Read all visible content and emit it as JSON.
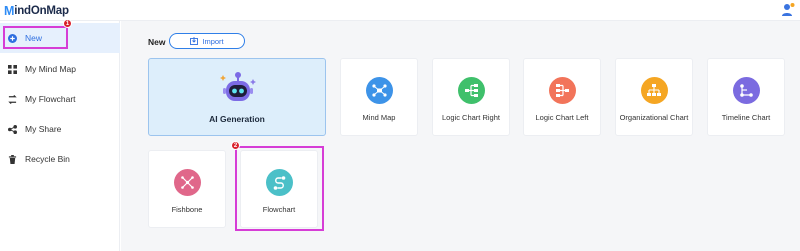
{
  "app": {
    "logo_prefix": "M",
    "logo_text": "indOnMap"
  },
  "sidebar": {
    "items": [
      {
        "label": "New",
        "icon": "plus-circle-icon",
        "active": true
      },
      {
        "label": "My Mind Map",
        "icon": "mind-map-icon"
      },
      {
        "label": "My Flowchart",
        "icon": "flowchart-icon"
      },
      {
        "label": "My Share",
        "icon": "share-icon"
      },
      {
        "label": "Recycle Bin",
        "icon": "trash-icon"
      }
    ]
  },
  "main": {
    "section_label": "New",
    "import_label": "Import",
    "templates": [
      {
        "label": "AI Generation",
        "icon": "robot-icon"
      },
      {
        "label": "Mind Map",
        "icon": "mind-map-icon",
        "color": "#3d93e8"
      },
      {
        "label": "Logic Chart Right",
        "icon": "logic-right-icon",
        "color": "#3fc06b"
      },
      {
        "label": "Logic Chart Left",
        "icon": "logic-left-icon",
        "color": "#f2745a"
      },
      {
        "label": "Organizational Chart",
        "icon": "org-chart-icon",
        "color": "#f5a623"
      },
      {
        "label": "Timeline Chart",
        "icon": "timeline-icon",
        "color": "#7b6be0"
      },
      {
        "label": "Fishbone",
        "icon": "fishbone-icon",
        "color": "#e0678a"
      },
      {
        "label": "Flowchart",
        "icon": "flowchart-icon",
        "color": "#4bc0c8"
      }
    ]
  },
  "annotations": {
    "step1": "1",
    "step2": "2",
    "highlight_color": "#d63dd6",
    "badge_color": "#d9212b"
  }
}
